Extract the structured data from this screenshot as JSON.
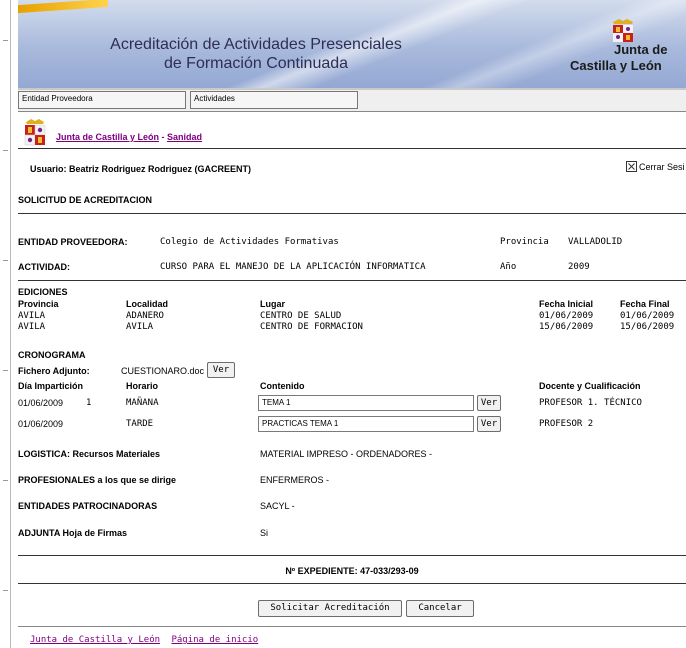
{
  "banner": {
    "title_line1": "Acreditación de Actividades Presenciales",
    "title_line2": "de Formación Continuada",
    "logo_line1": "Junta de",
    "logo_line2": "Castilla y León"
  },
  "tabs": [
    "Entidad Proveedora",
    "Actividades"
  ],
  "breadcrumb": {
    "link1": "Junta de Castilla y León",
    "sep": " - ",
    "link2": "Sanidad"
  },
  "user": "Usuario: Beatriz Rodriguez Rodriguez (GACREENT)",
  "logout": "Cerrar Sesi",
  "section_title": "SOLICITUD DE ACREDITACION",
  "entidad": {
    "label": "ENTIDAD PROVEEDORA:",
    "value": "Colegio de Actividades Formativas",
    "prov_label": "Provincia",
    "prov_value": "VALLADOLID"
  },
  "actividad": {
    "label": "ACTIVIDAD:",
    "value": "CURSO PARA EL MANEJO DE LA APLICACIÓN INFORMATICA",
    "anio_label": "Año",
    "anio_value": "2009"
  },
  "ediciones": {
    "title": "EDICIONES",
    "headers": {
      "provincia": "Provincia",
      "localidad": "Localidad",
      "lugar": "Lugar",
      "fecha_inicial": "Fecha Inicial",
      "fecha_final": "Fecha Final"
    },
    "rows": [
      {
        "provincia": "AVILA",
        "localidad": "ADANERO",
        "lugar": "CENTRO DE SALUD",
        "fecha_inicial": "01/06/2009",
        "fecha_final": "01/06/2009"
      },
      {
        "provincia": "AVILA",
        "localidad": "AVILA",
        "lugar": "CENTRO DE FORMACION",
        "fecha_inicial": "15/06/2009",
        "fecha_final": "15/06/2009"
      }
    ]
  },
  "cronograma": {
    "title": "CRONOGRAMA",
    "fichero_label": "Fichero Adjunto:",
    "fichero_value": "CUESTIONARO.doc",
    "ver_label": "Ver",
    "headers": {
      "dia": "Día Impartición",
      "horario": "Horario",
      "contenido": "Contenido",
      "docente": "Docente y Cualificación"
    },
    "rows": [
      {
        "dia": "01/06/2009",
        "num": "1",
        "horario": "MAÑANA",
        "contenido": "TEMA 1",
        "docente": "PROFESOR 1. TÉCNICO"
      },
      {
        "dia": "01/06/2009",
        "num": "",
        "horario": "TARDE",
        "contenido": "PRACTICAS TEMA 1",
        "docente": "PROFESOR 2"
      }
    ]
  },
  "logistica": {
    "label": "LOGISTICA: Recursos Materiales",
    "value": "MATERIAL IMPRESO - ORDENADORES -"
  },
  "profesionales": {
    "label": "PROFESIONALES a los que se dirige",
    "value": "ENFERMEROS -"
  },
  "patrocinadoras": {
    "label": "ENTIDADES PATROCINADORAS",
    "value": "SACYL -"
  },
  "hoja_firmas": {
    "label": "ADJUNTA Hoja de Firmas",
    "value": "Si"
  },
  "expediente": "Nº EXPEDIENTE: 47-033/293-09",
  "buttons": {
    "solicitar": "Solicitar Acreditación",
    "cancelar": "Cancelar"
  },
  "footer": {
    "link1": "Junta de Castilla y León",
    "link2": "Página de inicio"
  },
  "colors": {
    "banner": "#a8b9dc",
    "link": "#800080",
    "title_text": "#2e2e55"
  }
}
